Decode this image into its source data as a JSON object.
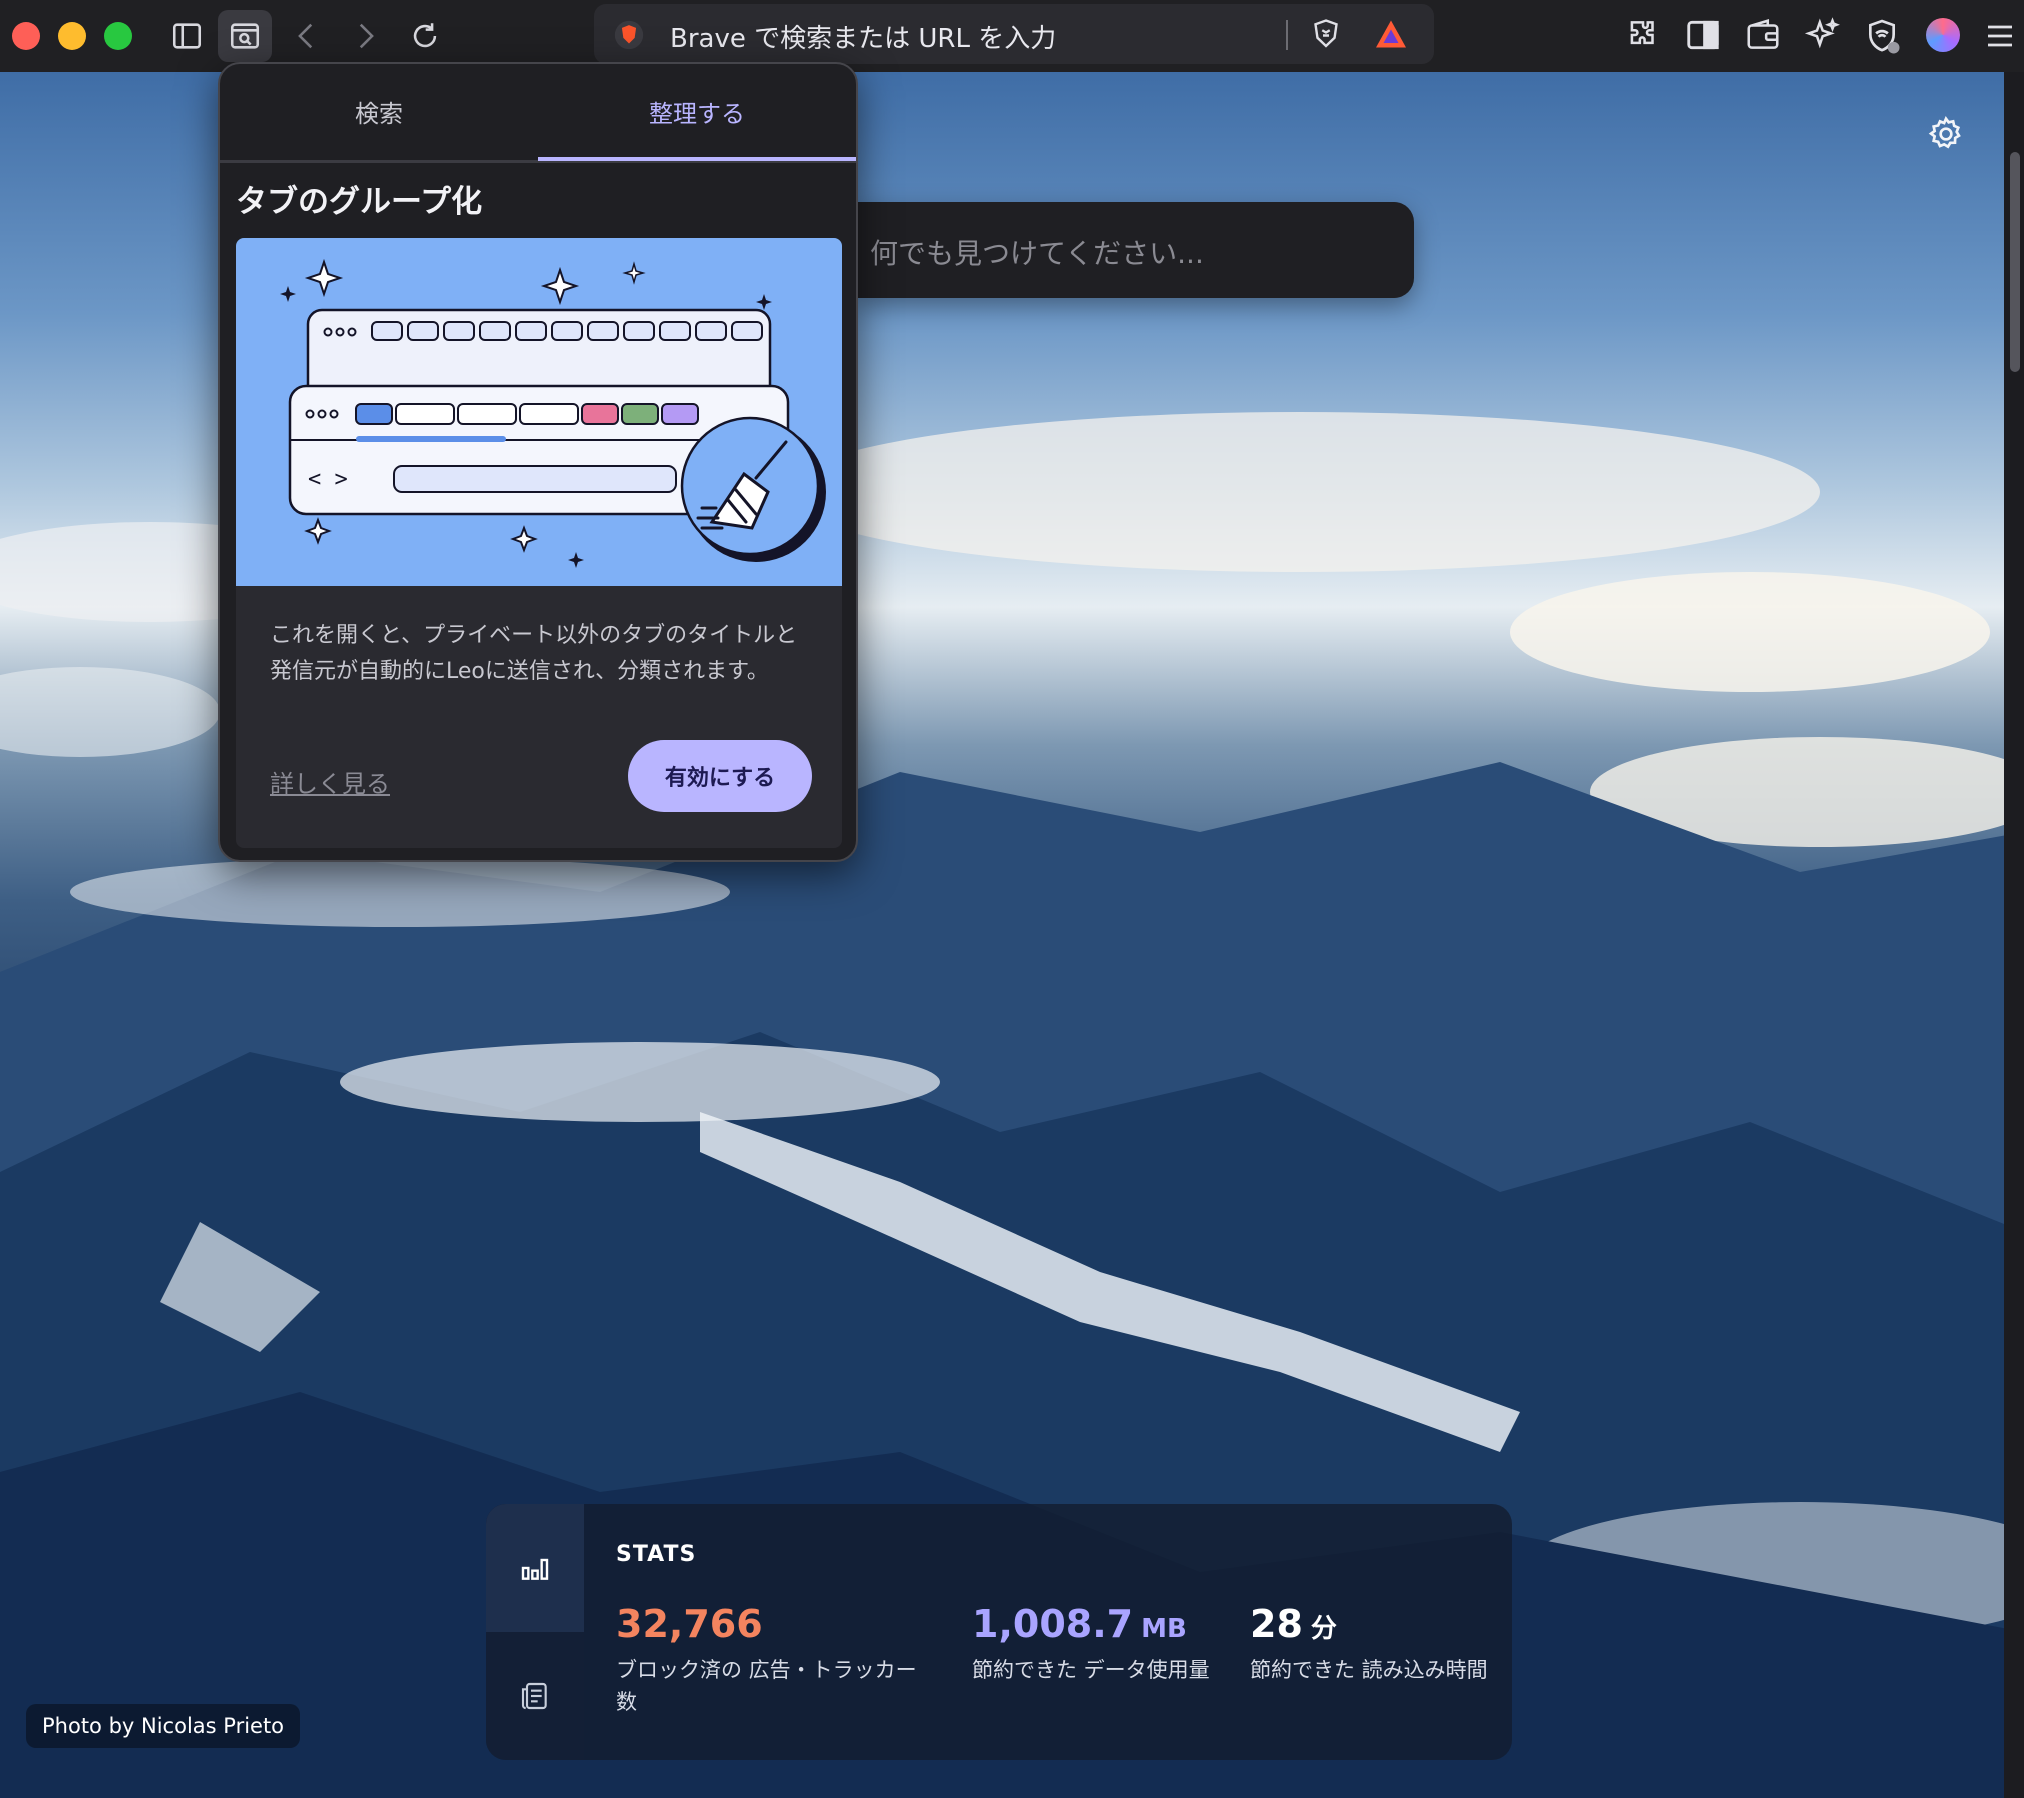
{
  "toolbar": {
    "url_placeholder": "Brave で検索または URL を入力"
  },
  "popup": {
    "tabs": [
      {
        "label": "検索"
      },
      {
        "label": "整理する"
      }
    ],
    "title": "タブのグループ化",
    "description": "これを開くと、プライベート以外のタブのタイトルと発信元が自動的にLeoに送信され、分類されます。",
    "learn_more": "詳しく見る",
    "enable_button": "有効にする"
  },
  "search": {
    "placeholder": "何でも見つけてください..."
  },
  "stats": {
    "title": "STATS",
    "items": [
      {
        "value": "32,766",
        "unit": "",
        "label": "ブロック済の 広告・トラッカー数",
        "color": "#f4845f"
      },
      {
        "value": "1,008.7",
        "unit": "MB",
        "label": "節約できた データ使用量",
        "color": "#a9a4ff"
      },
      {
        "value": "28",
        "unit": "分",
        "label": "節約できた 読み込み時間",
        "color": "#ffffff"
      }
    ]
  },
  "credit": "Photo by Nicolas Prieto",
  "colors": {
    "accent": "#b9b5ff",
    "illustration_bg": "#7fb0f6",
    "traffic_red": "#fe5f57",
    "traffic_yellow": "#febc2e",
    "traffic_green": "#28c840"
  }
}
